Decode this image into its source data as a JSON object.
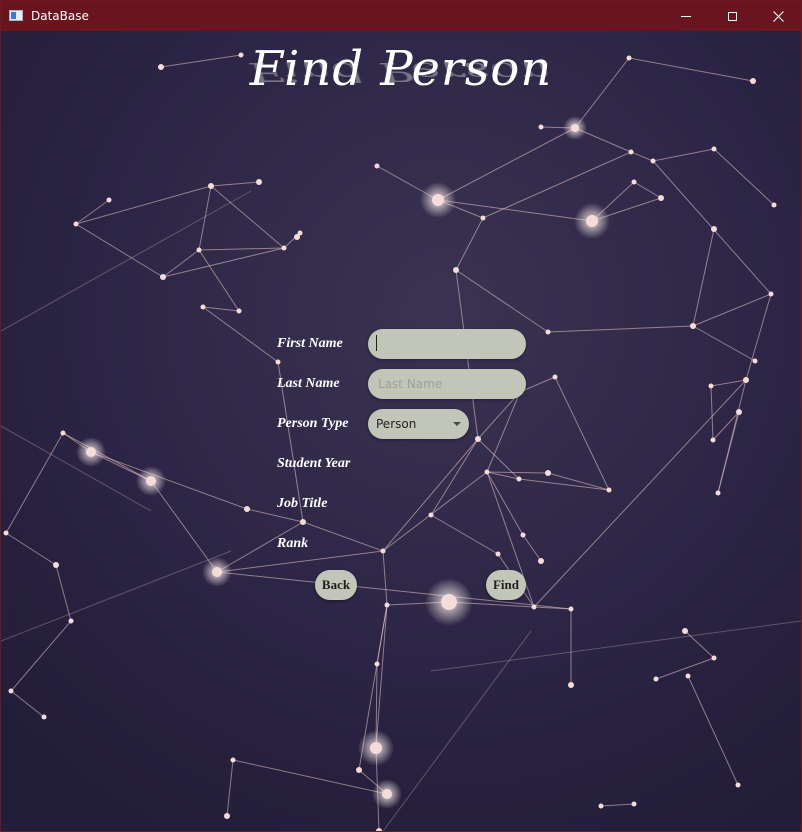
{
  "window": {
    "title": "DataBase"
  },
  "page": {
    "heading": "Find Person"
  },
  "form": {
    "first_name_label": "First Name",
    "first_name_value": "",
    "first_name_placeholder": "",
    "last_name_label": "Last Name",
    "last_name_value": "",
    "last_name_placeholder": "Last Name",
    "person_type_label": "Person Type",
    "person_type_value": "Person",
    "student_year_label": "Student Year",
    "job_title_label": "Job Title",
    "rank_label": "Rank"
  },
  "buttons": {
    "back": "Back",
    "find": "Find"
  },
  "icons": {
    "app": "app-window-icon",
    "minimize": "minimize-icon",
    "maximize": "maximize-icon",
    "close": "close-icon",
    "dropdown": "chevron-down-icon"
  },
  "colors": {
    "titlebar": "#6a1420",
    "background": "#26213d",
    "field": "#c2c6b9",
    "network": "#f1d4cf"
  }
}
